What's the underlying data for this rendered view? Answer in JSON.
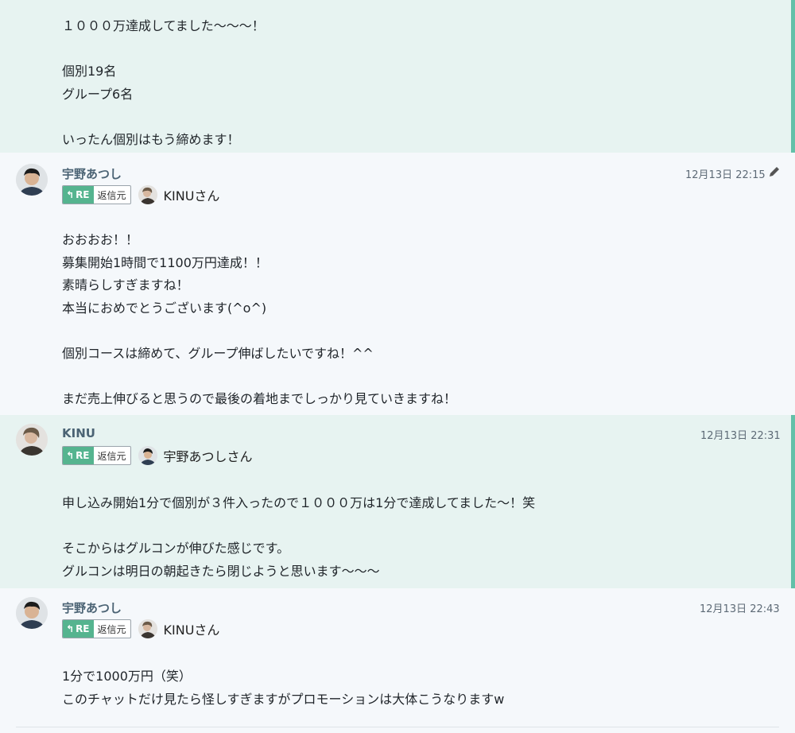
{
  "messages": [
    {
      "body": "１０００万達成してました〜〜〜！\n\n個別19名\nグループ6名\n\nいったん個別はもう締めます！"
    },
    {
      "author": "宇野あつし",
      "avatar": "photo-atsushi",
      "time": "12月13日 22:15",
      "edited_icon": "pencil-icon",
      "reply": {
        "re_label": "RE",
        "src_label": "返信元",
        "to_name": "KINUさん",
        "to_avatar": "photo-kinu"
      },
      "body": "おおおお！！\n募集開始1時間で1100万円達成！！\n素晴らしすぎますね！\n本当におめでとうございます(^o^)\n\n個別コースは締めて、グループ伸ばしたいですね！^^\n\nまだ売上伸びると思うので最後の着地までしっかり見ていきますね！"
    },
    {
      "author": "KINU",
      "avatar": "photo-kinu",
      "time": "12月13日 22:31",
      "reply": {
        "re_label": "RE",
        "src_label": "返信元",
        "to_name": "宇野あつしさん",
        "to_avatar": "photo-atsushi"
      },
      "body": "申し込み開始1分で個別が３件入ったので１０００万は1分で達成してました〜！笑\n\nそこからはグルコンが伸びた感じです。\nグルコンは明日の朝起きたら閉じようと思います〜〜〜"
    },
    {
      "author": "宇野あつし",
      "avatar": "photo-atsushi",
      "time": "12月13日 22:43",
      "reply": {
        "re_label": "RE",
        "src_label": "返信元",
        "to_name": "KINUさん",
        "to_avatar": "photo-kinu"
      },
      "body": "1分で1000万円（笑）\nこのチャットだけ見たら怪しすぎますがプロモーションは大体こうなりますw"
    }
  ],
  "colors": {
    "mine_bg": "#e7f3f1",
    "mine_bar": "#63c0a8",
    "re_green": "#55b48f",
    "name_color": "#4b6374"
  }
}
